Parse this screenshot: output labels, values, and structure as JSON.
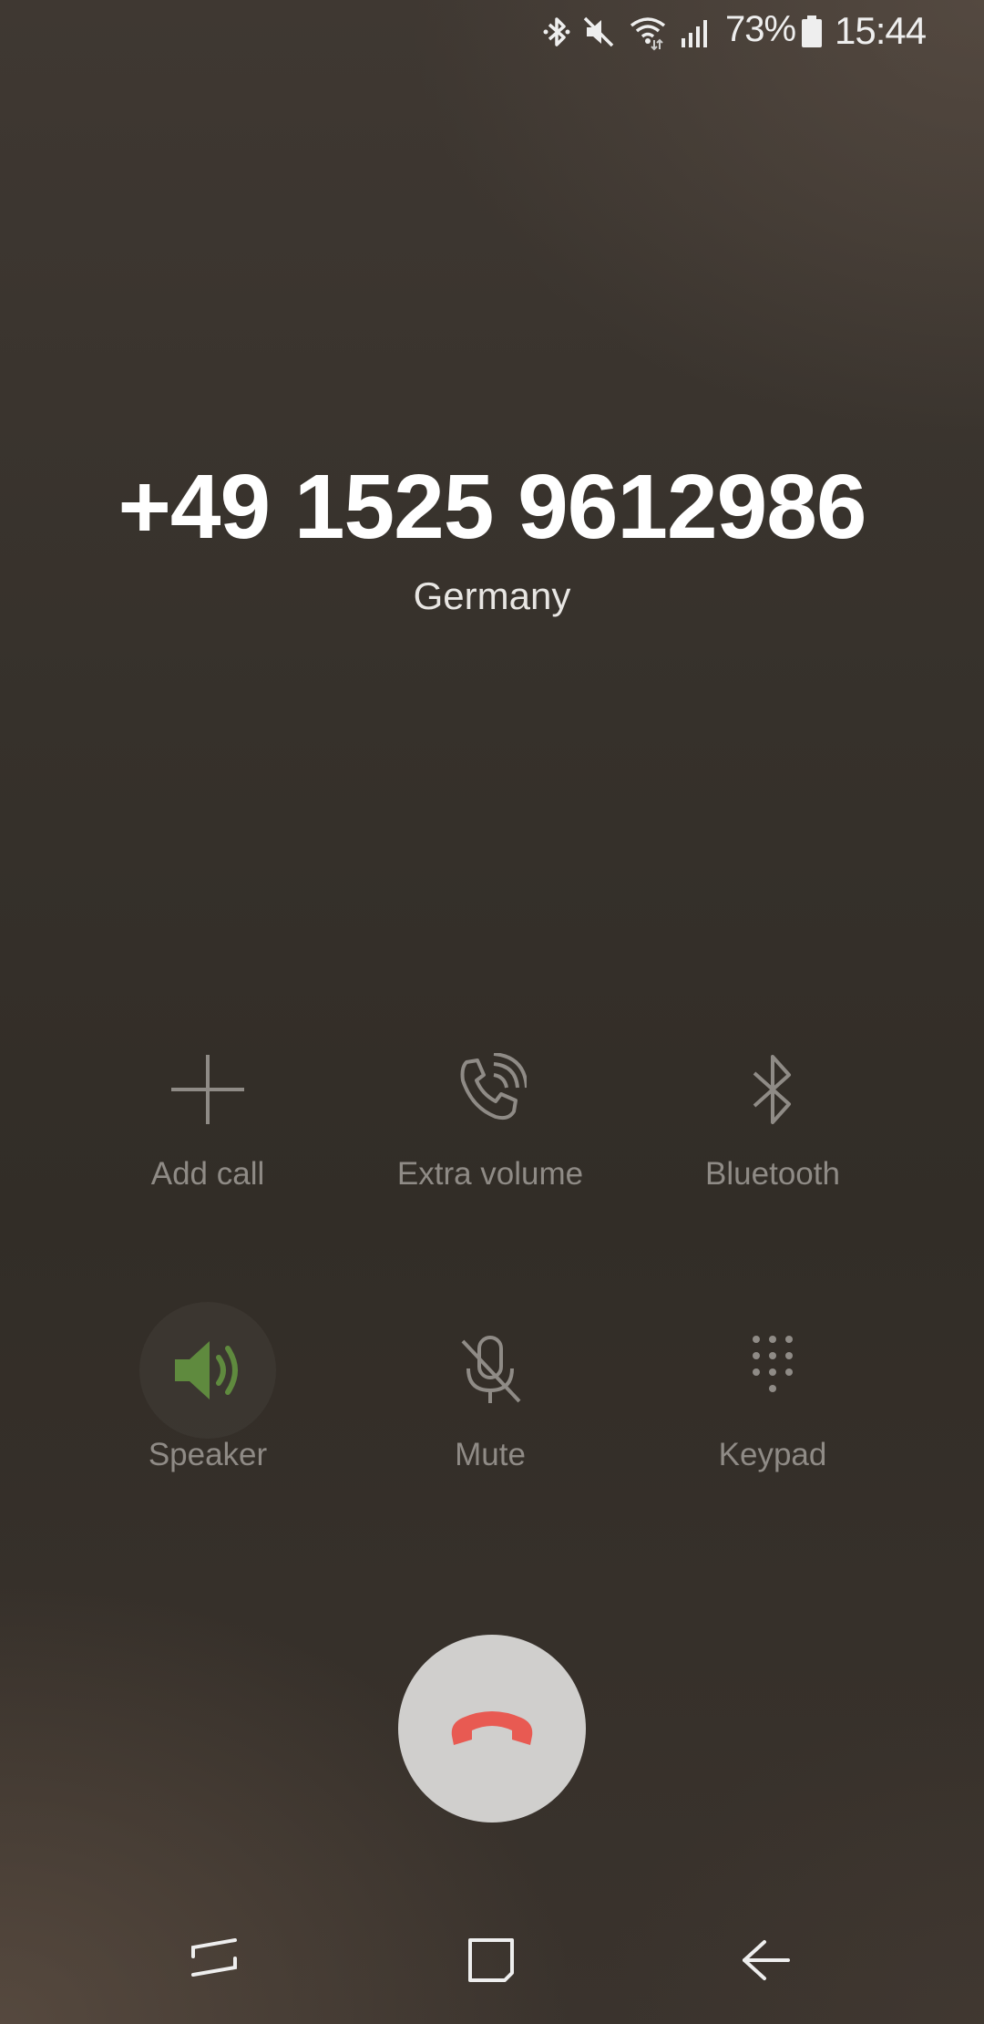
{
  "status_bar": {
    "battery_percent": "73%",
    "time": "15:44",
    "icons": [
      "bluetooth-icon",
      "mute-icon",
      "wifi-icon",
      "signal-icon",
      "battery-icon"
    ]
  },
  "caller": {
    "number": "+49 1525 9612986",
    "location": "Germany"
  },
  "actions": {
    "add_call": "Add call",
    "extra_volume": "Extra volume",
    "bluetooth": "Bluetooth",
    "speaker": "Speaker",
    "mute": "Mute",
    "keypad": "Keypad"
  },
  "colors": {
    "speaker_active": "#5f8a3e",
    "end_call_icon": "#e85a52",
    "end_call_bg": "#d0cfcd",
    "action_gray": "#8f8b86"
  },
  "navigation": {
    "buttons": [
      "recent-apps-icon",
      "home-icon",
      "back-icon"
    ]
  }
}
